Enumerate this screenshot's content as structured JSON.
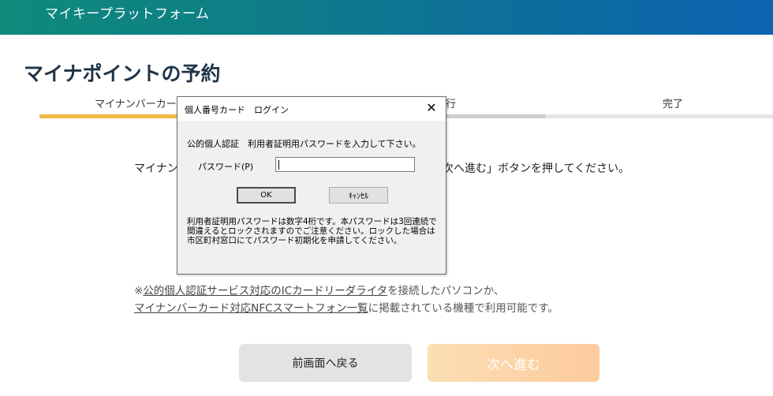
{
  "header": {
    "title": "マイキープラットフォーム"
  },
  "page": {
    "title": "マイナポイントの予約"
  },
  "steps": [
    {
      "label": "マイナンバーカー"
    },
    {
      "label": "発行"
    },
    {
      "label": "完了"
    }
  ],
  "instruction": {
    "left": "マイナン",
    "right": "次へ進む」ボタンを押してください。"
  },
  "notice": {
    "prefix": "※",
    "link1": "公的個人認証サービス対応のICカードリーダライタ",
    "text1": "を接続したパソコンか、",
    "link2": "マイナンバーカード対応NFCスマートフォン一覧",
    "text2": "に掲載されている機種で利用可能です。"
  },
  "buttons": {
    "back": "前画面へ戻る",
    "next": "次へ進む"
  },
  "dialog": {
    "title": "個人番号カード　ログイン",
    "close": "✕",
    "message": "公的個人認証　利用者証明用パスワードを入力して下さい。",
    "password_label": "パスワード(P)",
    "password_value": "",
    "ok": "OK",
    "cancel": "ｷｬﾝｾﾙ",
    "note": "利用者証明用パスワードは数字4桁です。本パスワードは3回連続で間違えるとロックされますのでご注意ください。ロックした場合は市区町村窓口にてパスワード初期化を申請してください。"
  },
  "colors": {
    "header_start": "#0f8a7a",
    "header_end": "#0c63b0",
    "progress_active": "#f2b945",
    "next_button": "#fdcb9d"
  }
}
